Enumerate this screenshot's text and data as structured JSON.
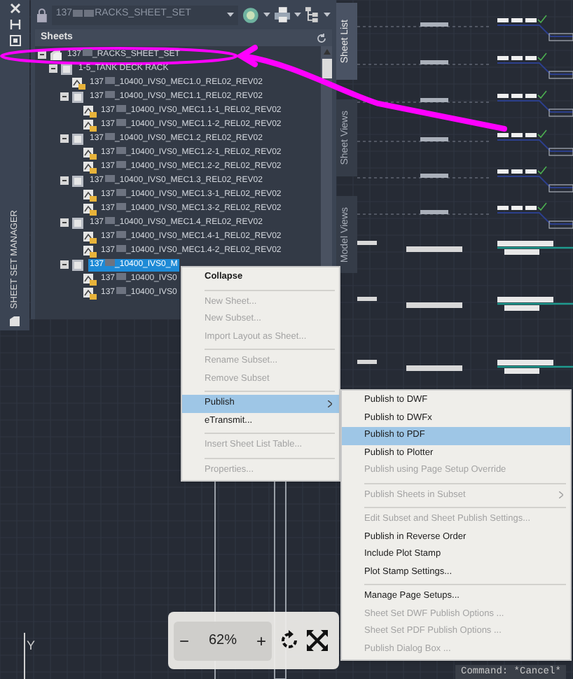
{
  "side_strip": {
    "title": "SHEET SET MANAGER"
  },
  "panel": {
    "set_dropdown": {
      "prefix": "137",
      "value": "RACKS_SHEET_SET"
    },
    "section_title": "Sheets",
    "tabs": [
      {
        "label": "Sheet List",
        "selected": true
      },
      {
        "label": "Sheet Views",
        "selected": false
      },
      {
        "label": "Model Views",
        "selected": false
      }
    ],
    "tree": [
      {
        "kind": "set",
        "prefix": "137",
        "label": "_RACKS_SHEET_SET",
        "selected": false,
        "expanded": true,
        "children": [
          {
            "kind": "subset",
            "label": "1-5_TANK DECK RACK",
            "selected": false,
            "expanded": true,
            "children": [
              {
                "kind": "sheet",
                "prefix": "137",
                "label": "_10400_IVS0_MEC1.0_REL02_REV02",
                "selected": false
              },
              {
                "kind": "subset",
                "prefix": "137",
                "label": "_10400_IVS0_MEC1.1_REL02_REV02",
                "selected": false,
                "expanded": true,
                "children": [
                  {
                    "kind": "sheet",
                    "prefix": "137",
                    "label": "_10400_IVS0_MEC1.1-1_REL02_REV02",
                    "selected": false
                  },
                  {
                    "kind": "sheet",
                    "prefix": "137",
                    "label": "_10400_IVS0_MEC1.1-2_REL02_REV02",
                    "selected": false
                  }
                ]
              },
              {
                "kind": "subset",
                "prefix": "137",
                "label": "_10400_IVS0_MEC1.2_REL02_REV02",
                "selected": false,
                "expanded": true,
                "children": [
                  {
                    "kind": "sheet",
                    "prefix": "137",
                    "label": "_10400_IVS0_MEC1.2-1_REL02_REV02",
                    "selected": false
                  },
                  {
                    "kind": "sheet",
                    "prefix": "137",
                    "label": "_10400_IVS0_MEC1.2-2_REL02_REV02",
                    "selected": false
                  }
                ]
              },
              {
                "kind": "subset",
                "prefix": "137",
                "label": "_10400_IVS0_MEC1.3_REL02_REV02",
                "selected": false,
                "expanded": true,
                "children": [
                  {
                    "kind": "sheet",
                    "prefix": "137",
                    "label": "_10400_IVS0_MEC1.3-1_REL02_REV02",
                    "selected": false
                  },
                  {
                    "kind": "sheet",
                    "prefix": "137",
                    "label": "_10400_IVS0_MEC1.3-2_REL02_REV02",
                    "selected": false
                  }
                ]
              },
              {
                "kind": "subset",
                "prefix": "137",
                "label": "_10400_IVS0_MEC1.4_REL02_REV02",
                "selected": false,
                "expanded": true,
                "children": [
                  {
                    "kind": "sheet",
                    "prefix": "137",
                    "label": "_10400_IVS0_MEC1.4-1_REL02_REV02",
                    "selected": false
                  },
                  {
                    "kind": "sheet",
                    "prefix": "137",
                    "label": "_10400_IVS0_MEC1.4-2_REL02_REV02",
                    "selected": false
                  }
                ]
              },
              {
                "kind": "subset",
                "prefix": "137",
                "label": "_10400_IVS0_M",
                "selected": true,
                "expanded": true,
                "children": [
                  {
                    "kind": "sheet",
                    "prefix": "137",
                    "label": "_10400_IVS0",
                    "selected": false
                  },
                  {
                    "kind": "sheet",
                    "prefix": "137",
                    "label": "_10400_IVS0",
                    "selected": false
                  }
                ]
              }
            ]
          }
        ]
      }
    ]
  },
  "context_menu": [
    {
      "label": "Collapse",
      "kind": "bold",
      "disabled": false,
      "selected": false
    },
    {
      "kind": "separator"
    },
    {
      "label": "New Sheet...",
      "kind": "item",
      "disabled": true,
      "selected": false
    },
    {
      "label": "New Subset...",
      "kind": "item",
      "disabled": true,
      "selected": false
    },
    {
      "label": "Import Layout as Sheet...",
      "kind": "item",
      "disabled": true,
      "selected": false
    },
    {
      "kind": "separator"
    },
    {
      "label": "Rename Subset...",
      "kind": "item",
      "disabled": true,
      "selected": false
    },
    {
      "label": "Remove Subset",
      "kind": "item",
      "disabled": true,
      "selected": false
    },
    {
      "kind": "separator"
    },
    {
      "label": "Publish",
      "kind": "submenu",
      "disabled": false,
      "selected": true
    },
    {
      "label": "eTransmit...",
      "kind": "item",
      "disabled": false,
      "selected": false
    },
    {
      "kind": "separator"
    },
    {
      "label": "Insert Sheet List Table...",
      "kind": "item",
      "disabled": true,
      "selected": false
    },
    {
      "kind": "separator"
    },
    {
      "label": "Properties...",
      "kind": "item",
      "disabled": true,
      "selected": false
    }
  ],
  "publish_submenu": [
    {
      "label": "Publish to DWF",
      "kind": "item",
      "disabled": false,
      "selected": false
    },
    {
      "label": "Publish to DWFx",
      "kind": "item",
      "disabled": false,
      "selected": false
    },
    {
      "label": "Publish to PDF",
      "kind": "item",
      "disabled": false,
      "selected": true
    },
    {
      "label": "Publish to Plotter",
      "kind": "item",
      "disabled": false,
      "selected": false
    },
    {
      "label": "Publish using Page Setup Override",
      "kind": "item",
      "disabled": true,
      "selected": false
    },
    {
      "kind": "separator"
    },
    {
      "label": "Publish Sheets in Subset",
      "kind": "submenu",
      "disabled": true,
      "selected": false
    },
    {
      "kind": "separator"
    },
    {
      "label": "Edit Subset and Sheet Publish Settings...",
      "kind": "item",
      "disabled": true,
      "selected": false
    },
    {
      "label": "Publish in Reverse Order",
      "kind": "item",
      "disabled": false,
      "selected": false
    },
    {
      "label": "Include Plot Stamp",
      "kind": "item",
      "disabled": false,
      "selected": false
    },
    {
      "label": "Plot Stamp Settings...",
      "kind": "item",
      "disabled": false,
      "selected": false
    },
    {
      "kind": "separator"
    },
    {
      "label": "Manage Page Setups...",
      "kind": "item",
      "disabled": false,
      "selected": false
    },
    {
      "label": "Sheet Set DWF Publish Options ...",
      "kind": "item",
      "disabled": true,
      "selected": false
    },
    {
      "label": "Sheet Set PDF Publish Options ...",
      "kind": "item",
      "disabled": true,
      "selected": false
    },
    {
      "label": "Publish Dialog Box ...",
      "kind": "item",
      "disabled": true,
      "selected": false
    }
  ],
  "zoom_toolbar": {
    "minus": "−",
    "value": "62%",
    "plus": "+"
  },
  "ucs_label": "Y",
  "command_line": "Command: *Cancel*"
}
